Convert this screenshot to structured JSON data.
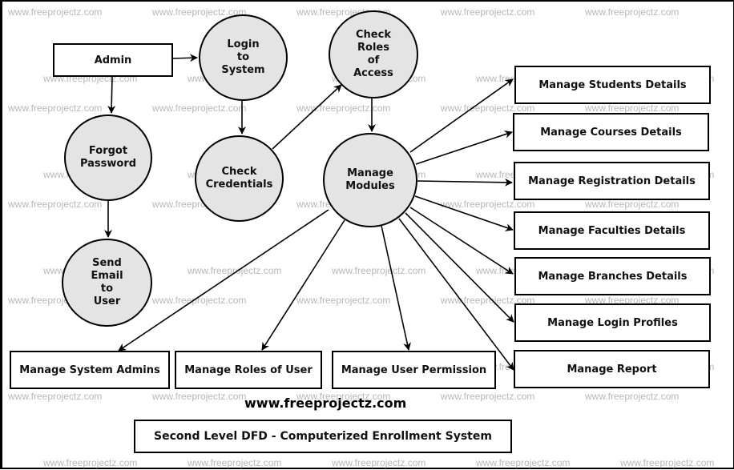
{
  "diagram": {
    "title": "Second Level DFD - Computerized Enrollment System",
    "website": "www.freeprojectz.com",
    "watermark": "www.freeprojectz.com",
    "colors": {
      "process_fill": "#e4e4e4",
      "stroke": "#000000",
      "watermark": "#b8b8b8"
    },
    "entities": {
      "admin": "Admin",
      "manage_students": "Manage Students Details",
      "manage_courses": "Manage Courses Details",
      "manage_registration": "Manage Registration Details",
      "manage_faculties": "Manage Faculties Details",
      "manage_branches": "Manage Branches Details",
      "manage_login_profiles": "Manage Login Profiles",
      "manage_report": "Manage Report",
      "manage_system_admins": "Manage System Admins",
      "manage_roles": "Manage Roles of User",
      "manage_permission": "Manage User Permission"
    },
    "processes": {
      "login": "Login\nto\nSystem",
      "check_roles": "Check\nRoles\nof\nAccess",
      "forgot_password": "Forgot\nPassword",
      "check_credentials": "Check\nCredentials",
      "manage_modules": "Manage\nModules",
      "send_email": "Send\nEmail\nto\nUser"
    },
    "flows": [
      [
        "admin",
        "login"
      ],
      [
        "admin",
        "forgot_password"
      ],
      [
        "login",
        "check_credentials"
      ],
      [
        "check_credentials",
        "check_roles"
      ],
      [
        "check_roles",
        "manage_modules"
      ],
      [
        "forgot_password",
        "send_email"
      ],
      [
        "manage_modules",
        "manage_students"
      ],
      [
        "manage_modules",
        "manage_courses"
      ],
      [
        "manage_modules",
        "manage_registration"
      ],
      [
        "manage_modules",
        "manage_faculties"
      ],
      [
        "manage_modules",
        "manage_branches"
      ],
      [
        "manage_modules",
        "manage_login_profiles"
      ],
      [
        "manage_modules",
        "manage_report"
      ],
      [
        "manage_modules",
        "manage_system_admins"
      ],
      [
        "manage_modules",
        "manage_roles"
      ],
      [
        "manage_modules",
        "manage_permission"
      ]
    ]
  }
}
